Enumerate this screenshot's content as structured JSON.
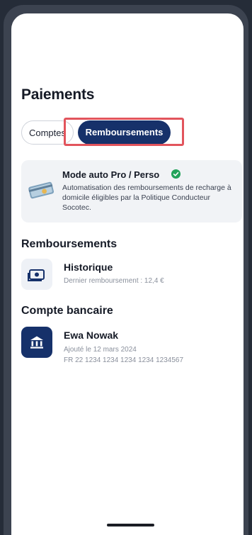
{
  "page": {
    "title": "Paiements"
  },
  "tabs": [
    {
      "label": "Comptes",
      "active": false
    },
    {
      "label": "Remboursements",
      "active": true
    }
  ],
  "promo": {
    "title": "Mode auto Pro / Perso",
    "description": "Automatisation des remboursements de recharge à domicile éligibles par la Politique Conducteur Socotec.",
    "icon": "check-circle-icon",
    "illustration": "credit-card-illustration"
  },
  "reimbursements": {
    "section_title": "Remboursements",
    "history": {
      "title": "Historique",
      "subtitle": "Dernier remboursement : 12,4 €",
      "icon": "banknote-icon"
    }
  },
  "bank_account": {
    "section_title": "Compte bancaire",
    "name": "Ewa Nowak",
    "added": "Ajouté le 12 mars 2024",
    "iban": "FR 22 1234 1234 1234 1234 1234567",
    "icon": "bank-icon"
  },
  "colors": {
    "accent": "#16316a",
    "success": "#22a35a",
    "highlight": "#e2545c",
    "background": "#252c38"
  }
}
